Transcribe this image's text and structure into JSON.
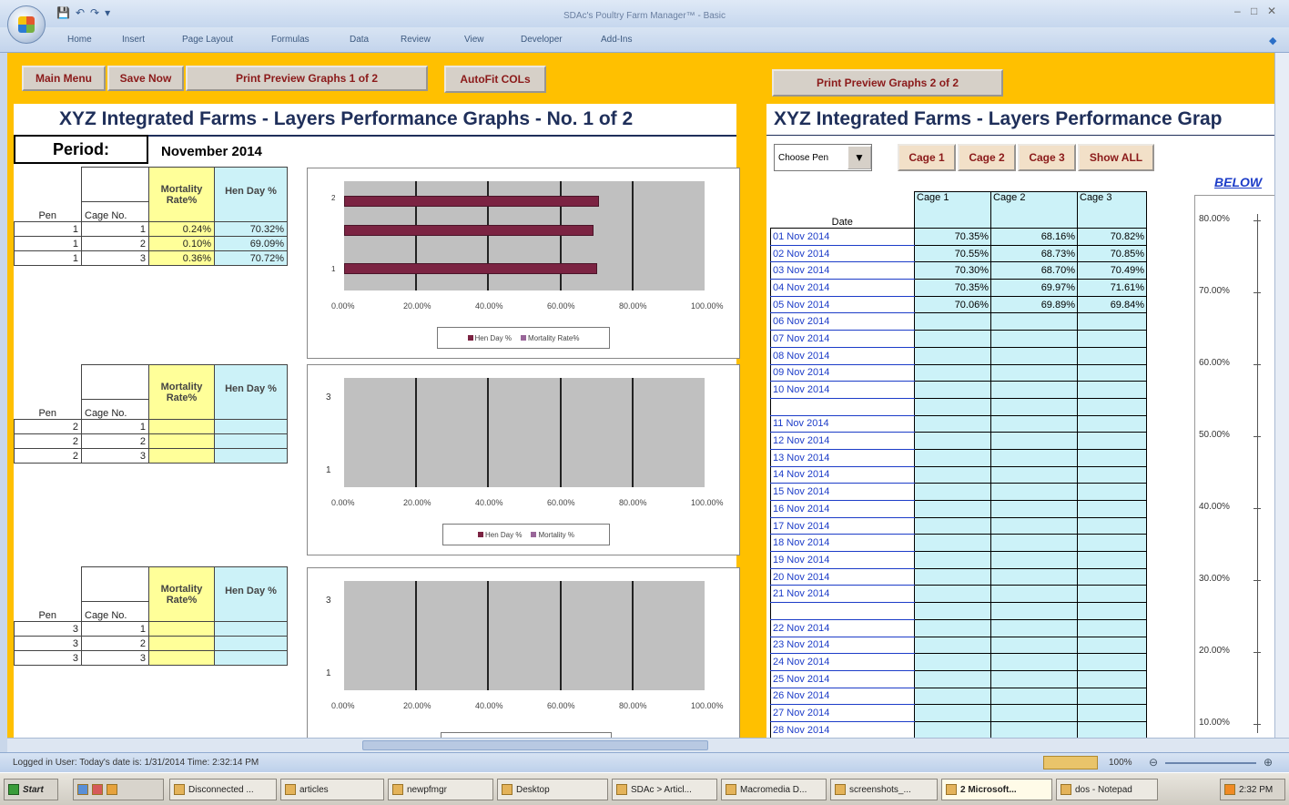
{
  "window": {
    "title": "SDAc's Poultry Farm Manager™ - Basic"
  },
  "ribbon": {
    "tabs": [
      "Home",
      "Insert",
      "Page Layout",
      "Formulas",
      "Data",
      "Review",
      "View",
      "Developer",
      "Add-Ins"
    ]
  },
  "toolbar": {
    "main_menu": "Main Menu",
    "save_now": "Save Now",
    "print1": "Print Preview Graphs 1 of 2",
    "autofit": "AutoFit COLs",
    "print2": "Print Preview Graphs 2 of 2"
  },
  "left": {
    "title": "XYZ Integrated Farms - Layers Performance Graphs - No. 1 of 2",
    "period_label": "Period:",
    "period_value": "November 2014",
    "headers": {
      "pen": "Pen",
      "cage": "Cage No.",
      "mortality": "Mortality Rate%",
      "henday": "Hen Day %"
    },
    "blocks": [
      {
        "rows": [
          {
            "pen": "1",
            "cage": "1",
            "mort": "0.24%",
            "hen": "70.32%"
          },
          {
            "pen": "1",
            "cage": "2",
            "mort": "0.10%",
            "hen": "69.09%"
          },
          {
            "pen": "1",
            "cage": "3",
            "mort": "0.36%",
            "hen": "70.72%"
          }
        ],
        "legend": [
          "Hen Day %",
          "Mortality Rate%"
        ]
      },
      {
        "rows": [
          {
            "pen": "2",
            "cage": "1",
            "mort": "",
            "hen": ""
          },
          {
            "pen": "2",
            "cage": "2",
            "mort": "",
            "hen": ""
          },
          {
            "pen": "2",
            "cage": "3",
            "mort": "",
            "hen": ""
          }
        ],
        "legend": [
          "Hen Day %",
          "Mortality %"
        ]
      },
      {
        "rows": [
          {
            "pen": "3",
            "cage": "1",
            "mort": "",
            "hen": ""
          },
          {
            "pen": "3",
            "cage": "2",
            "mort": "",
            "hen": ""
          },
          {
            "pen": "3",
            "cage": "3",
            "mort": "",
            "hen": ""
          }
        ],
        "legend": []
      }
    ],
    "x_ticks": [
      "0.00%",
      "20.00%",
      "40.00%",
      "60.00%",
      "80.00%",
      "100.00%"
    ]
  },
  "right": {
    "title": "XYZ Integrated Farms - Layers Performance Grap",
    "choose_pen": "Choose Pen",
    "cage_buttons": [
      "Cage 1",
      "Cage 2",
      "Cage 3",
      "Show ALL"
    ],
    "below_label": "BELOW",
    "headers": [
      "Date",
      "Cage 1",
      "Cage 2",
      "Cage 3"
    ],
    "rows": [
      [
        "01 Nov 2014",
        "70.35%",
        "68.16%",
        "70.82%"
      ],
      [
        "02 Nov 2014",
        "70.55%",
        "68.73%",
        "70.85%"
      ],
      [
        "03 Nov 2014",
        "70.30%",
        "68.70%",
        "70.49%"
      ],
      [
        "04 Nov 2014",
        "70.35%",
        "69.97%",
        "71.61%"
      ],
      [
        "05 Nov 2014",
        "70.06%",
        "69.89%",
        "69.84%"
      ],
      [
        "06 Nov 2014",
        "",
        "",
        ""
      ],
      [
        "07 Nov 2014",
        "",
        "",
        ""
      ],
      [
        "08 Nov 2014",
        "",
        "",
        ""
      ],
      [
        "09 Nov 2014",
        "",
        "",
        ""
      ],
      [
        "10 Nov 2014",
        "",
        "",
        ""
      ],
      [
        "",
        null,
        null,
        null
      ],
      [
        "11 Nov 2014",
        "",
        "",
        ""
      ],
      [
        "12 Nov 2014",
        "",
        "",
        ""
      ],
      [
        "13 Nov 2014",
        "",
        "",
        ""
      ],
      [
        "14 Nov 2014",
        "",
        "",
        ""
      ],
      [
        "15 Nov 2014",
        "",
        "",
        ""
      ],
      [
        "16 Nov 2014",
        "",
        "",
        ""
      ],
      [
        "17 Nov 2014",
        "",
        "",
        ""
      ],
      [
        "18 Nov 2014",
        "",
        "",
        ""
      ],
      [
        "19 Nov 2014",
        "",
        "",
        ""
      ],
      [
        "20 Nov 2014",
        "",
        "",
        ""
      ],
      [
        "21 Nov 2014",
        "",
        "",
        ""
      ],
      [
        "",
        null,
        null,
        null
      ],
      [
        "22 Nov 2014",
        "",
        "",
        ""
      ],
      [
        "23 Nov 2014",
        "",
        "",
        ""
      ],
      [
        "24 Nov 2014",
        "",
        "",
        ""
      ],
      [
        "25 Nov 2014",
        "",
        "",
        ""
      ],
      [
        "26 Nov 2014",
        "",
        "",
        ""
      ],
      [
        "27 Nov 2014",
        "",
        "",
        ""
      ],
      [
        "28 Nov 2014",
        "",
        "",
        ""
      ]
    ],
    "y_ticks": [
      "80.00%",
      "70.00%",
      "60.00%",
      "50.00%",
      "40.00%",
      "30.00%",
      "20.00%",
      "10.00%"
    ]
  },
  "chart_data": [
    {
      "type": "bar",
      "orientation": "horizontal",
      "categories": [
        "1",
        "2",
        "3"
      ],
      "series": [
        {
          "name": "Hen Day %",
          "values": [
            70.32,
            69.09,
            70.72
          ]
        },
        {
          "name": "Mortality Rate%",
          "values": [
            0.24,
            0.1,
            0.36
          ]
        }
      ],
      "xlim": [
        0,
        100
      ],
      "colors": {
        "Hen Day %": "#7b2342",
        "Mortality Rate%": "#996699"
      }
    },
    {
      "type": "bar",
      "orientation": "horizontal",
      "categories": [
        "1",
        "3"
      ],
      "series": [
        {
          "name": "Hen Day %",
          "values": []
        },
        {
          "name": "Mortality %",
          "values": []
        }
      ],
      "xlim": [
        0,
        100
      ]
    },
    {
      "type": "bar",
      "orientation": "horizontal",
      "categories": [
        "1",
        "3"
      ],
      "series": [],
      "xlim": [
        0,
        100
      ]
    }
  ],
  "status": {
    "text": "Logged in User:  Today's date is: 1/31/2014  Time: 2:32:14 PM",
    "zoom": "100%"
  },
  "taskbar": {
    "start": "Start",
    "items": [
      "Disconnected ...",
      "articles",
      "newpfmgr",
      "Desktop",
      "SDAc > Articl...",
      "Macromedia D...",
      "screenshots_...",
      "2 Microsoft...",
      "dos - Notepad"
    ],
    "clock": "2:32 PM"
  }
}
